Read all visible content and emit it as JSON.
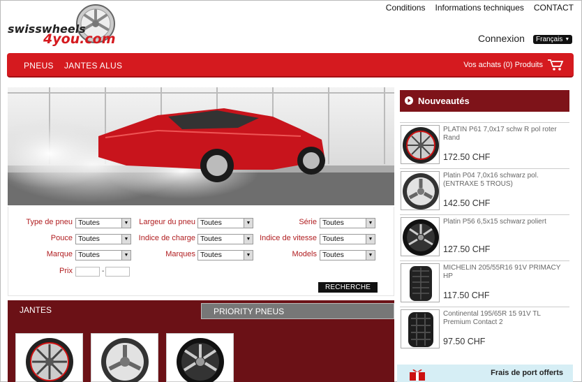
{
  "brand": {
    "name_line1": "swisswheels",
    "name_line2": "4you.com"
  },
  "top_nav": [
    "Conditions",
    "Informations techniques",
    "CONTACT"
  ],
  "login": "Connexion",
  "language": "Français",
  "menu": {
    "items": [
      "PNEUS",
      "JANTES ALUS"
    ],
    "cart_label": "Vos achats (0) Produits"
  },
  "search": {
    "type_label": "Type de pneu",
    "type_value": "Toutes",
    "largeur_label": "Largeur du pneu",
    "largeur_value": "Toutes",
    "serie_label": "Série",
    "serie_value": "Toutes",
    "pouce_label": "Pouce",
    "pouce_value": "Toutes",
    "charge_label": "Indice de charge",
    "charge_value": "Toutes",
    "vitesse_label": "Indice de vitesse",
    "vitesse_value": "Toutes",
    "marque_label": "Marque",
    "marque_value": "Toutes",
    "marques_label": "Marques",
    "marques_value": "Toutes",
    "models_label": "Models",
    "models_value": "Toutes",
    "prix_label": "Prix",
    "prix_sep": "-",
    "button": "RECHERCHE"
  },
  "tabs": {
    "jantes": "JANTES",
    "priority": "PRIORITY PNEUS"
  },
  "sidebar": {
    "title": "Nouveautés",
    "products": [
      {
        "name": "PLATIN P61 7,0x17 schw R pol roter Rand",
        "price": "172.50 CHF",
        "icon": "rim-icon"
      },
      {
        "name": "Platin P04 7,0x16 schwarz pol. (ENTRAXE 5 TROUS)",
        "price": "142.50 CHF",
        "icon": "rim-icon"
      },
      {
        "name": "Platin P56 6,5x15 schwarz poliert",
        "price": "127.50 CHF",
        "icon": "rim-icon"
      },
      {
        "name": "MICHELIN 205/55R16 91V PRIMACY HP",
        "price": "117.50 CHF",
        "icon": "tire-icon"
      },
      {
        "name": "Continental 195/65R 15 91V TL Premium Contact 2",
        "price": "97.50 CHF",
        "icon": "tire-icon"
      }
    ]
  },
  "promo": "Frais de port offerts",
  "colors": {
    "accent_red": "#d51a1f",
    "dark_red": "#7e1319",
    "label_red": "#b01c1f"
  }
}
